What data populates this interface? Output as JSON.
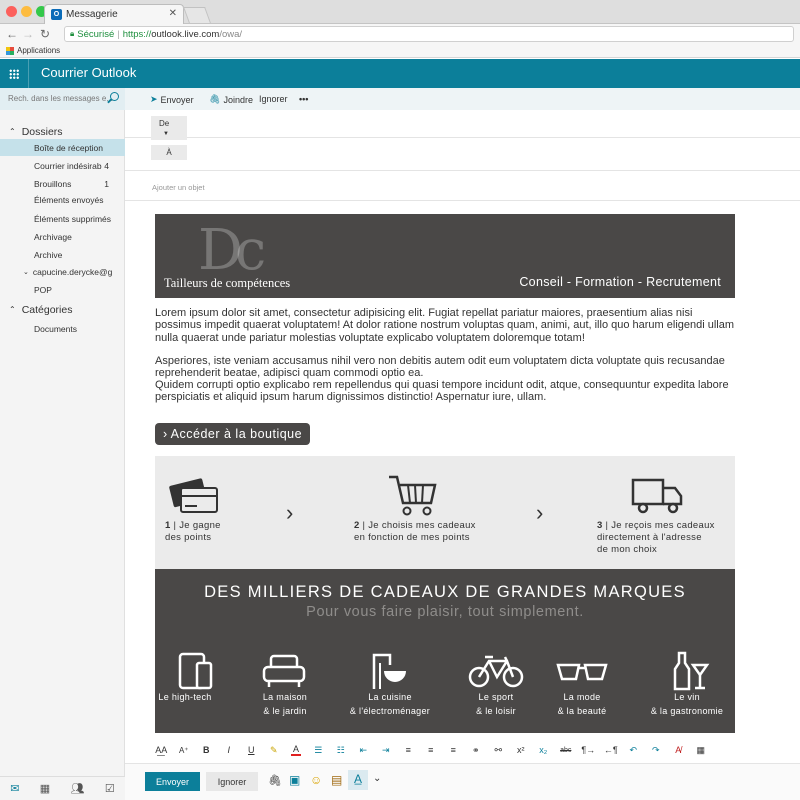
{
  "browser": {
    "tab_title": "Messagerie",
    "secure_label": "Sécurisé",
    "url_prefix": "https://",
    "url_host": "outlook.live.com",
    "url_path": "/owa/",
    "bookmark_apps": "Applications"
  },
  "header": {
    "app_title": "Courrier Outlook"
  },
  "sidebar": {
    "search_placeholder": "Rech. dans les messages e...",
    "folders_heading": "Dossiers",
    "folders": [
      {
        "label": "Boîte de réception",
        "count": ""
      },
      {
        "label": "Courrier indésirab",
        "count": "4"
      },
      {
        "label": "Brouillons",
        "count": "1"
      },
      {
        "label": "Éléments envoyés",
        "count": ""
      },
      {
        "label": "Éléments supprimés",
        "count": ""
      },
      {
        "label": "Archivage",
        "count": ""
      },
      {
        "label": "Archive",
        "count": ""
      },
      {
        "label": "capucine.derycke@g",
        "count": ""
      },
      {
        "label": "POP",
        "count": ""
      }
    ],
    "categories_heading": "Catégories",
    "categories": [
      {
        "label": "Documents"
      }
    ]
  },
  "toolbar": {
    "send": "Envoyer",
    "attach": "Joindre",
    "ignore": "Ignorer",
    "more": "•••"
  },
  "compose": {
    "from_label": "De",
    "to_label": "À",
    "subject_placeholder": "Ajouter un objet"
  },
  "email": {
    "banner_logo": "Dc",
    "banner_title": "Tailleurs de compétences",
    "banner_tagline": "Conseil - Formation - Recrutement",
    "para1": "Lorem ipsum dolor sit amet, consectetur adipisicing elit. Fugiat repellat pariatur maiores, praesentium alias nisi possimus impedit quaerat voluptatem! At dolor ratione nostrum voluptas quam, animi, aut, illo quo harum eligendi ullam nulla quaerat unde pariatur molestias voluptate explicabo voluptatem doloremque totam!",
    "para2": "Asperiores, iste veniam accusamus nihil vero non debitis autem odit eum voluptatem dicta voluptate quis recusandae reprehenderit beatae, adipisci quam commodi optio ea.",
    "para3": "Quidem corrupti optio explicabo rem repellendus qui quasi tempore incidunt odit, atque, consequuntur expedita labore perspiciatis et aliquid ipsum harum dignissimos distinctio! Aspernatur iure, ullam.",
    "shop_button": "Accéder à la boutique",
    "steps": [
      {
        "num": "1",
        "line1": "Je gagne",
        "line2": "des points",
        "line3": ""
      },
      {
        "num": "2",
        "line1": "Je choisis mes cadeaux",
        "line2": "en fonction de mes points",
        "line3": ""
      },
      {
        "num": "3",
        "line1": "Je reçois mes cadeaux",
        "line2": "directement à l'adresse",
        "line3": "de mon choix"
      }
    ],
    "promo_title": "DES MILLIERS DE CADEAUX DE GRANDES MARQUES",
    "promo_subtitle": "Pour vous faire plaisir,  tout simplement.",
    "categories": [
      {
        "line1": "Le high-tech",
        "line2": ""
      },
      {
        "line1": "La maison",
        "line2": "& le jardin"
      },
      {
        "line1": "La cuisine",
        "line2": "& l'électroménager"
      },
      {
        "line1": "Le sport",
        "line2": "& le loisir"
      },
      {
        "line1": "La mode",
        "line2": "& la beauté"
      },
      {
        "line1": "Le vin",
        "line2": "& la gastronomie"
      }
    ]
  },
  "footer": {
    "send": "Envoyer",
    "ignore": "Ignorer"
  },
  "colors": {
    "brand": "#0c7f9a",
    "banner": "#4a4847",
    "selected_folder": "#c5e1ea"
  }
}
